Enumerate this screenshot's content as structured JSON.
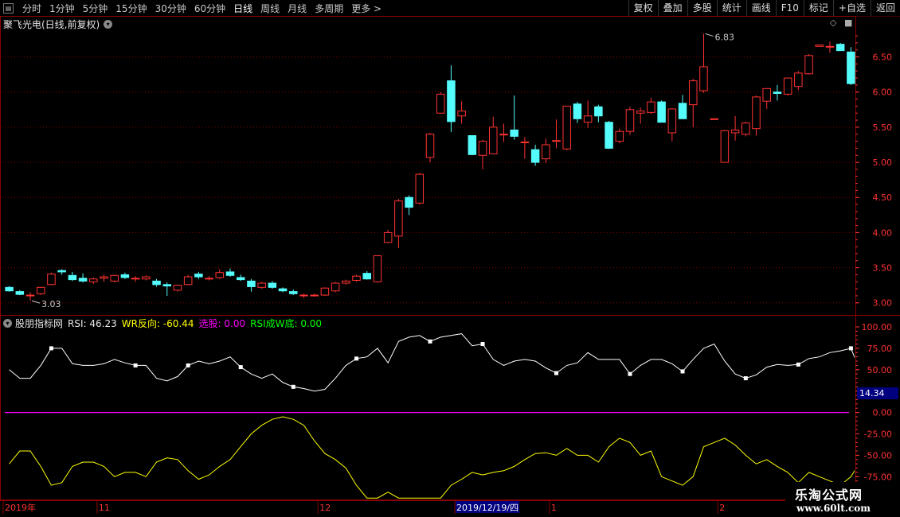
{
  "toolbar": {
    "periods": [
      "分时",
      "1分钟",
      "5分钟",
      "15分钟",
      "30分钟",
      "60分钟",
      "日线",
      "周线",
      "月线",
      "多周期",
      "更多"
    ],
    "active_period": "日线",
    "more_arrow": ">",
    "right_buttons": [
      "复权",
      "叠加",
      "多股",
      "统计",
      "画线",
      "F10",
      "标记",
      "+自选",
      "返回"
    ]
  },
  "stock": {
    "title": "聚飞光电(日线,前复权)",
    "dropdown_glyph": "▾"
  },
  "top_icons": {
    "diamond": "◇",
    "square": "■"
  },
  "indicator": {
    "name": "股朋指标网",
    "rsi_label": "RSI:",
    "rsi_value": "46.23",
    "wr_label": "WR反向:",
    "wr_value": "-60.44",
    "xg_label": "选股:",
    "xg_value": "0.00",
    "rw_label": "RSI成W底:",
    "rw_value": "0.00",
    "cursor_value": "14.34"
  },
  "colors": {
    "up": "#ff3232",
    "down": "#54fcfc",
    "grid": "#8b0000",
    "axis": "#ff3232",
    "rsi": "#ffffff",
    "wr": "#ffff00",
    "zero": "#ff00ff",
    "wr_label": "#ffff00",
    "xg_label": "#ff00ff",
    "rw_label": "#00ff00"
  },
  "watermark": {
    "line1": "乐淘公式网",
    "line2": "www.60lt.com"
  },
  "chart_data": [
    {
      "type": "candlestick",
      "ylim": [
        2.85,
        6.88
      ],
      "y_ticks": [
        "6.50",
        "6.00",
        "5.50",
        "5.00",
        "4.50",
        "4.00",
        "3.50",
        "3.00"
      ],
      "y_tick_values": [
        6.5,
        6.0,
        5.5,
        5.0,
        4.5,
        4.0,
        3.5,
        3.0
      ],
      "annotations": [
        {
          "text": "6.83",
          "index": 66,
          "value": 6.83
        },
        {
          "text": "3.03",
          "index": 2,
          "value": 3.03
        }
      ],
      "candles": [
        {
          "o": 3.22,
          "h": 3.24,
          "l": 3.16,
          "c": 3.17
        },
        {
          "o": 3.16,
          "h": 3.18,
          "l": 3.11,
          "c": 3.12
        },
        {
          "o": 3.1,
          "h": 3.15,
          "l": 3.03,
          "c": 3.11
        },
        {
          "o": 3.13,
          "h": 3.23,
          "l": 3.11,
          "c": 3.22
        },
        {
          "o": 3.26,
          "h": 3.43,
          "l": 3.25,
          "c": 3.41
        },
        {
          "o": 3.46,
          "h": 3.48,
          "l": 3.4,
          "c": 3.44
        },
        {
          "o": 3.39,
          "h": 3.44,
          "l": 3.31,
          "c": 3.33
        },
        {
          "o": 3.35,
          "h": 3.42,
          "l": 3.29,
          "c": 3.31
        },
        {
          "o": 3.3,
          "h": 3.36,
          "l": 3.27,
          "c": 3.34
        },
        {
          "o": 3.35,
          "h": 3.4,
          "l": 3.3,
          "c": 3.37
        },
        {
          "o": 3.31,
          "h": 3.4,
          "l": 3.29,
          "c": 3.39
        },
        {
          "o": 3.4,
          "h": 3.43,
          "l": 3.34,
          "c": 3.36
        },
        {
          "o": 3.35,
          "h": 3.38,
          "l": 3.3,
          "c": 3.35
        },
        {
          "o": 3.34,
          "h": 3.39,
          "l": 3.32,
          "c": 3.37
        },
        {
          "o": 3.31,
          "h": 3.34,
          "l": 3.23,
          "c": 3.26
        },
        {
          "o": 3.26,
          "h": 3.29,
          "l": 3.1,
          "c": 3.24
        },
        {
          "o": 3.18,
          "h": 3.26,
          "l": 3.16,
          "c": 3.25
        },
        {
          "o": 3.26,
          "h": 3.4,
          "l": 3.25,
          "c": 3.37
        },
        {
          "o": 3.41,
          "h": 3.44,
          "l": 3.34,
          "c": 3.37
        },
        {
          "o": 3.35,
          "h": 3.38,
          "l": 3.32,
          "c": 3.35
        },
        {
          "o": 3.36,
          "h": 3.48,
          "l": 3.34,
          "c": 3.43
        },
        {
          "o": 3.44,
          "h": 3.49,
          "l": 3.37,
          "c": 3.39
        },
        {
          "o": 3.36,
          "h": 3.4,
          "l": 3.31,
          "c": 3.33
        },
        {
          "o": 3.31,
          "h": 3.34,
          "l": 3.16,
          "c": 3.23
        },
        {
          "o": 3.22,
          "h": 3.3,
          "l": 3.2,
          "c": 3.28
        },
        {
          "o": 3.28,
          "h": 3.31,
          "l": 3.2,
          "c": 3.22
        },
        {
          "o": 3.2,
          "h": 3.22,
          "l": 3.15,
          "c": 3.17
        },
        {
          "o": 3.16,
          "h": 3.19,
          "l": 3.11,
          "c": 3.13
        },
        {
          "o": 3.1,
          "h": 3.13,
          "l": 3.07,
          "c": 3.11
        },
        {
          "o": 3.11,
          "h": 3.13,
          "l": 3.09,
          "c": 3.11
        },
        {
          "o": 3.11,
          "h": 3.22,
          "l": 3.1,
          "c": 3.21
        },
        {
          "o": 3.17,
          "h": 3.3,
          "l": 3.15,
          "c": 3.28
        },
        {
          "o": 3.28,
          "h": 3.33,
          "l": 3.26,
          "c": 3.31
        },
        {
          "o": 3.32,
          "h": 3.4,
          "l": 3.3,
          "c": 3.38
        },
        {
          "o": 3.42,
          "h": 3.45,
          "l": 3.33,
          "c": 3.34
        },
        {
          "o": 3.3,
          "h": 3.68,
          "l": 3.29,
          "c": 3.67
        },
        {
          "o": 3.86,
          "h": 4.04,
          "l": 3.85,
          "c": 4.0
        },
        {
          "o": 3.95,
          "h": 4.48,
          "l": 3.78,
          "c": 4.45
        },
        {
          "o": 4.5,
          "h": 4.53,
          "l": 4.25,
          "c": 4.36
        },
        {
          "o": 4.42,
          "h": 4.85,
          "l": 4.4,
          "c": 4.83
        },
        {
          "o": 5.07,
          "h": 5.42,
          "l": 5.0,
          "c": 5.4
        },
        {
          "o": 5.7,
          "h": 6.0,
          "l": 5.7,
          "c": 5.97
        },
        {
          "o": 6.16,
          "h": 6.38,
          "l": 5.43,
          "c": 5.58
        },
        {
          "o": 5.66,
          "h": 5.87,
          "l": 5.55,
          "c": 5.73
        },
        {
          "o": 5.38,
          "h": 5.38,
          "l": 5.1,
          "c": 5.11
        },
        {
          "o": 5.1,
          "h": 5.32,
          "l": 4.9,
          "c": 5.3
        },
        {
          "o": 5.12,
          "h": 5.65,
          "l": 5.12,
          "c": 5.5
        },
        {
          "o": 5.4,
          "h": 5.55,
          "l": 5.29,
          "c": 5.4
        },
        {
          "o": 5.46,
          "h": 5.95,
          "l": 5.32,
          "c": 5.37
        },
        {
          "o": 5.28,
          "h": 5.36,
          "l": 5.05,
          "c": 5.29
        },
        {
          "o": 5.18,
          "h": 5.25,
          "l": 4.95,
          "c": 5.0
        },
        {
          "o": 5.05,
          "h": 5.34,
          "l": 4.99,
          "c": 5.25
        },
        {
          "o": 5.3,
          "h": 5.61,
          "l": 5.2,
          "c": 5.31
        },
        {
          "o": 5.19,
          "h": 5.72,
          "l": 5.17,
          "c": 5.8
        },
        {
          "o": 5.83,
          "h": 5.86,
          "l": 5.56,
          "c": 5.62
        },
        {
          "o": 5.57,
          "h": 5.88,
          "l": 5.49,
          "c": 5.66
        },
        {
          "o": 5.79,
          "h": 5.82,
          "l": 5.57,
          "c": 5.66
        },
        {
          "o": 5.57,
          "h": 5.59,
          "l": 5.19,
          "c": 5.2
        },
        {
          "o": 5.3,
          "h": 5.48,
          "l": 5.27,
          "c": 5.44
        },
        {
          "o": 5.44,
          "h": 5.79,
          "l": 5.39,
          "c": 5.75
        },
        {
          "o": 5.7,
          "h": 5.78,
          "l": 5.55,
          "c": 5.73
        },
        {
          "o": 5.71,
          "h": 5.92,
          "l": 5.69,
          "c": 5.86
        },
        {
          "o": 5.86,
          "h": 5.88,
          "l": 5.57,
          "c": 5.57
        },
        {
          "o": 5.42,
          "h": 5.77,
          "l": 5.3,
          "c": 5.76
        },
        {
          "o": 5.84,
          "h": 5.96,
          "l": 5.62,
          "c": 5.62
        },
        {
          "o": 5.82,
          "h": 6.19,
          "l": 5.5,
          "c": 6.16
        },
        {
          "o": 6.02,
          "h": 6.83,
          "l": 5.99,
          "c": 6.36
        },
        {
          "o": 5.62,
          "h": 5.62,
          "l": 5.62,
          "c": 5.62
        },
        {
          "o": 5.0,
          "h": 5.46,
          "l": 5.0,
          "c": 5.45
        },
        {
          "o": 5.42,
          "h": 5.66,
          "l": 5.31,
          "c": 5.46
        },
        {
          "o": 5.4,
          "h": 5.58,
          "l": 5.37,
          "c": 5.56
        },
        {
          "o": 5.48,
          "h": 5.95,
          "l": 5.38,
          "c": 5.93
        },
        {
          "o": 5.87,
          "h": 6.05,
          "l": 5.76,
          "c": 6.05
        },
        {
          "o": 6.0,
          "h": 6.1,
          "l": 5.88,
          "c": 5.98
        },
        {
          "o": 5.97,
          "h": 6.19,
          "l": 5.95,
          "c": 6.2
        },
        {
          "o": 6.08,
          "h": 6.3,
          "l": 6.03,
          "c": 6.27
        },
        {
          "o": 6.26,
          "h": 6.54,
          "l": 6.25,
          "c": 6.52
        },
        {
          "o": 6.65,
          "h": 6.67,
          "l": 6.65,
          "c": 6.67
        },
        {
          "o": 6.64,
          "h": 6.72,
          "l": 6.56,
          "c": 6.65
        },
        {
          "o": 6.68,
          "h": 6.7,
          "l": 6.59,
          "c": 6.59
        },
        {
          "o": 6.57,
          "h": 6.64,
          "l": 6.1,
          "c": 6.12
        }
      ]
    },
    {
      "type": "line",
      "ylim": [
        -100,
        100
      ],
      "y_ticks": [
        "100.00",
        "75.00",
        "50.00",
        "25.00",
        "0.00",
        "-25.00",
        "-50.00",
        "-75.00"
      ],
      "y_tick_values": [
        100,
        75,
        50,
        25,
        0,
        -25,
        -50,
        -75
      ],
      "x_labels": [
        "2019年",
        "11",
        "12",
        "2019/12/19/四",
        "1",
        "2"
      ],
      "x_label_indices": [
        0,
        9,
        30,
        43,
        52,
        68
      ],
      "series": [
        {
          "name": "RSI",
          "values": [
            50,
            40,
            40,
            55,
            75,
            75,
            57,
            55,
            55,
            57,
            62,
            58,
            55,
            55,
            40,
            37,
            42,
            55,
            60,
            57,
            60,
            65,
            53,
            45,
            40,
            45,
            35,
            30,
            28,
            25,
            27,
            40,
            55,
            63,
            65,
            75,
            58,
            83,
            88,
            90,
            83,
            88,
            90,
            92,
            78,
            80,
            62,
            55,
            60,
            62,
            60,
            52,
            46,
            55,
            58,
            70,
            62,
            62,
            62,
            45,
            55,
            62,
            62,
            57,
            48,
            62,
            75,
            80,
            60,
            45,
            40,
            44,
            53,
            56,
            55,
            56,
            63,
            65,
            70,
            72,
            75,
            45
          ]
        },
        {
          "name": "WR反向",
          "values": [
            -60,
            -45,
            -45,
            -63,
            -85,
            -82,
            -63,
            -58,
            -58,
            -63,
            -75,
            -70,
            -70,
            -75,
            -58,
            -53,
            -55,
            -68,
            -78,
            -73,
            -63,
            -55,
            -40,
            -25,
            -15,
            -8,
            -5,
            -8,
            -15,
            -33,
            -48,
            -55,
            -65,
            -85,
            -100,
            -100,
            -93,
            -100,
            -100,
            -100,
            -100,
            -100,
            -85,
            -78,
            -70,
            -73,
            -70,
            -68,
            -63,
            -55,
            -48,
            -47,
            -50,
            -42,
            -50,
            -50,
            -58,
            -40,
            -30,
            -35,
            -50,
            -45,
            -75,
            -80,
            -85,
            -75,
            -40,
            -35,
            -30,
            -38,
            -50,
            -60,
            -55,
            -63,
            -70,
            -82,
            -70,
            -75,
            -80,
            -85,
            -75,
            -55
          ]
        }
      ],
      "reference_lines": [
        {
          "name": "zero",
          "value": 0
        }
      ],
      "rsi_markers": [
        4,
        12,
        17,
        22,
        27,
        33,
        40,
        45,
        52,
        59,
        64,
        70,
        75,
        80
      ]
    }
  ]
}
